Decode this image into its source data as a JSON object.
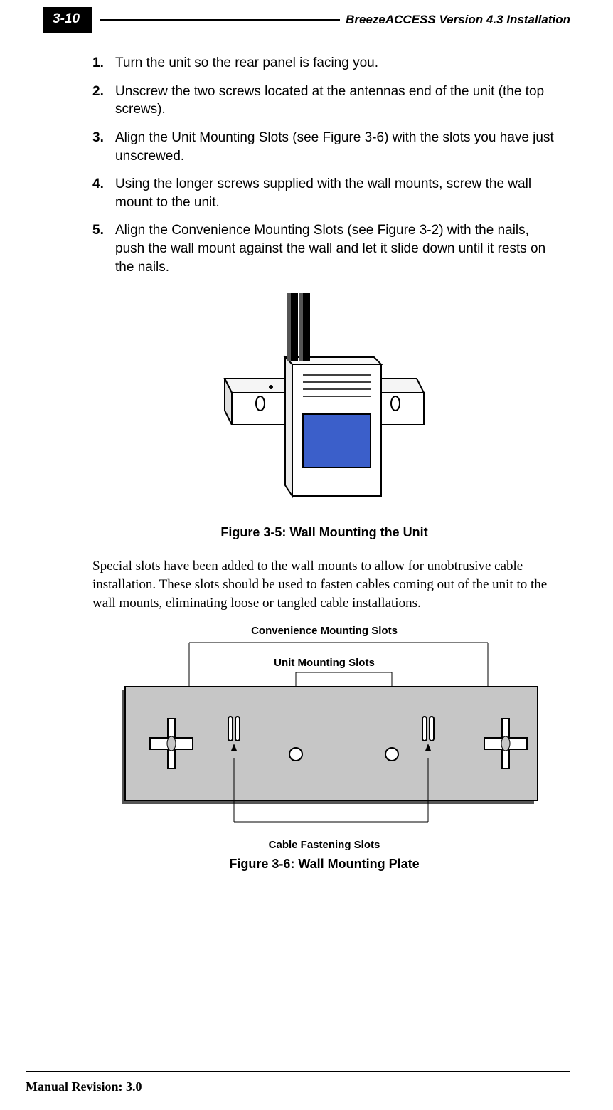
{
  "header": {
    "page_number": "3-10",
    "running_title": "BreezeACCESS Version 4.3 Installation"
  },
  "steps": [
    {
      "n": "1.",
      "text": "Turn the unit so the rear panel is facing you."
    },
    {
      "n": "2.",
      "text": "Unscrew the two screws located at the antennas end of the unit (the top screws)."
    },
    {
      "n": "3.",
      "text": "Align the Unit Mounting Slots (see Figure 3-6) with the slots you have just unscrewed."
    },
    {
      "n": "4.",
      "text": "Using the longer screws supplied with the wall mounts, screw the wall mount to the unit."
    },
    {
      "n": "5.",
      "text": "Align the Convenience Mounting Slots (see Figure 3-2) with the nails, push the wall mount against the wall and let it slide down until it rests on the nails."
    }
  ],
  "figure5": {
    "caption": "Figure 3-5: Wall Mounting the Unit"
  },
  "body_paragraph": "Special slots have been added to the wall mounts to allow for unobtrusive cable installation. These slots should be used to fasten cables coming out of the unit to the wall mounts, eliminating loose or tangled cable installations.",
  "figure6": {
    "label_convenience": "Convenience Mounting Slots",
    "label_unit": "Unit Mounting Slots",
    "label_cable": "Cable Fastening Slots",
    "caption": "Figure 3-6: Wall Mounting Plate"
  },
  "footer": {
    "revision": "Manual Revision: 3.0"
  }
}
